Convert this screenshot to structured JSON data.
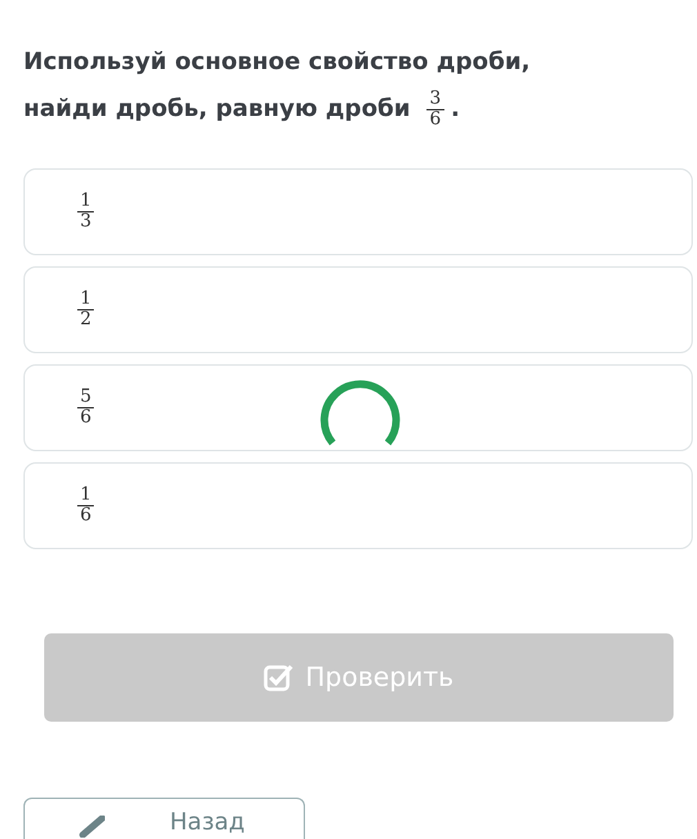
{
  "question": {
    "text": "Используй основное свойство дроби, найди дробь, равную дроби",
    "fraction": {
      "numerator": "3",
      "denominator": "6"
    },
    "end": "."
  },
  "options": [
    {
      "numerator": "1",
      "denominator": "3",
      "selected": false
    },
    {
      "numerator": "1",
      "denominator": "2",
      "selected": false
    },
    {
      "numerator": "5",
      "denominator": "6",
      "selected": false
    },
    {
      "numerator": "1",
      "denominator": "6",
      "selected": false
    }
  ],
  "loading": true,
  "check_button": {
    "label": "Проверить",
    "disabled": true
  },
  "back_button": {
    "label": "Назад"
  }
}
